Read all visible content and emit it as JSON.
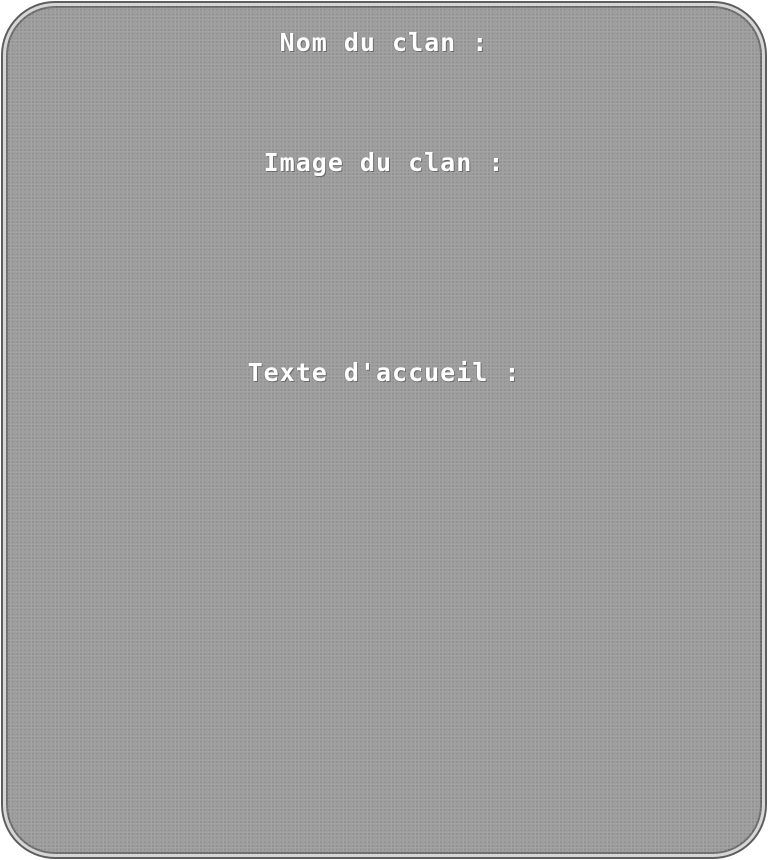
{
  "form": {
    "clan_name_label": "Nom du clan :",
    "clan_image_label": "Image du clan :",
    "welcome_text_label": "Texte d'accueil :"
  }
}
